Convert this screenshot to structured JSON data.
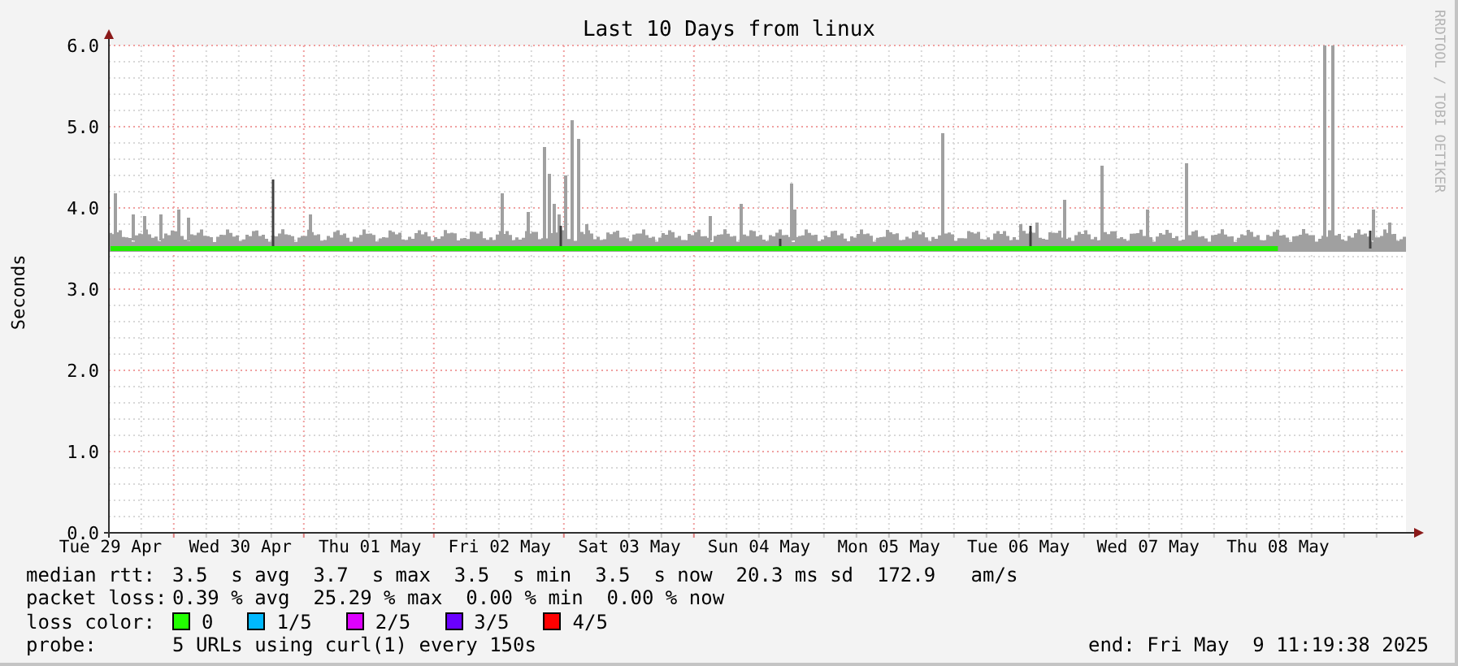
{
  "chart": {
    "side_credit": "RRDTOOL / TOBI OETIKER",
    "chart_data": {
      "type": "line",
      "title": "Last 10 Days from linux",
      "ylabel": "Seconds",
      "categories": [
        "Tue 29 Apr",
        "Wed 30 Apr",
        "Thu 01 May",
        "Fri 02 May",
        "Sat 03 May",
        "Sun 04 May",
        "Mon 05 May",
        "Tue 06 May",
        "Wed 07 May",
        "Thu 08 May"
      ],
      "ylim": [
        0,
        6
      ],
      "grid": true,
      "yticks": [
        {
          "value": 0,
          "label": "0.0"
        },
        {
          "value": 1,
          "label": "1.0"
        },
        {
          "value": 2,
          "label": "2.0"
        },
        {
          "value": 3,
          "label": "3.0"
        },
        {
          "value": 4,
          "label": "4.0"
        },
        {
          "value": 5,
          "label": "5.0"
        },
        {
          "value": 6,
          "label": "6.0"
        }
      ],
      "series": [
        {
          "color": "#22ee00",
          "values": [
            3.5,
            3.5,
            3.5,
            3.5,
            3.5,
            3.5,
            3.5,
            3.5,
            3.5,
            3.5
          ]
        }
      ]
    }
  },
  "legend": {
    "rows": [
      {
        "kind": "text",
        "label": "median rtt:",
        "value": "3.5  s avg  3.7  s max  3.5  s min  3.5  s now  20.3 ms sd  172.9   am/s"
      },
      {
        "kind": "text",
        "label": "packet loss:",
        "value": "0.39 % avg  25.29 % max  0.00 % min  0.00 % now"
      },
      {
        "kind": "swatches",
        "label": "loss color:",
        "items": [
          {
            "label": "0",
            "color": "#22ff00"
          },
          {
            "label": "1/5",
            "color": "#00b8ff"
          },
          {
            "label": "2/5",
            "color": "#dd00ff"
          },
          {
            "label": "3/5",
            "color": "#6a00ff"
          },
          {
            "label": "4/5",
            "color": "#ff0000"
          }
        ]
      },
      {
        "kind": "probe",
        "label": "probe:",
        "value": "5 URLs using curl(1) every 150s",
        "end": "end: Fri May  9 11:19:38 2025"
      }
    ]
  }
}
